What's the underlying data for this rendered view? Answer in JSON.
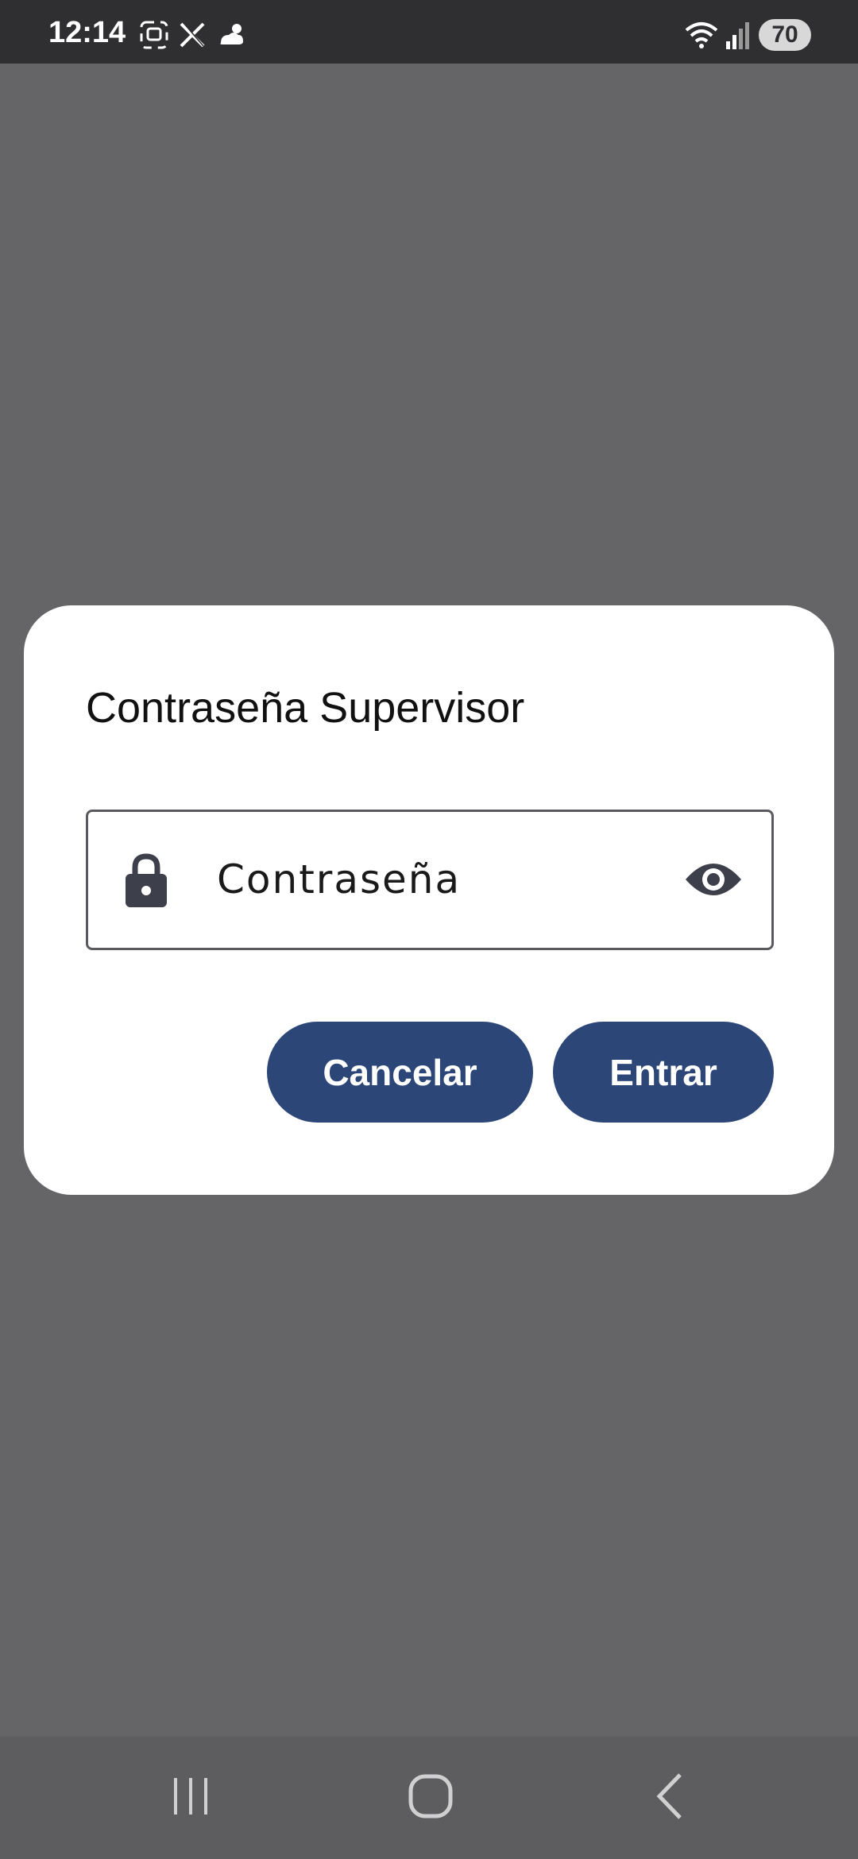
{
  "status_bar": {
    "time": "12:14",
    "battery": "70",
    "icons": [
      "screenshot-icon",
      "x-app-icon",
      "weather-icon",
      "wifi-icon",
      "signal-icon"
    ]
  },
  "dialog": {
    "title": "Contraseña Supervisor",
    "password_field": {
      "placeholder": "Contraseña",
      "value": "",
      "leading_icon": "lock-icon",
      "trailing_icon": "eye-icon"
    },
    "buttons": {
      "cancel_label": "Cancelar",
      "enter_label": "Entrar"
    }
  },
  "navigation_bar": {
    "icons": [
      "recent-apps-icon",
      "home-icon",
      "back-icon"
    ]
  },
  "colors": {
    "scrim": "#656567",
    "status_bar": "#2f2f31",
    "dialog_background": "#ffffff",
    "button": "#2c4677",
    "button_text": "#ffffff"
  }
}
